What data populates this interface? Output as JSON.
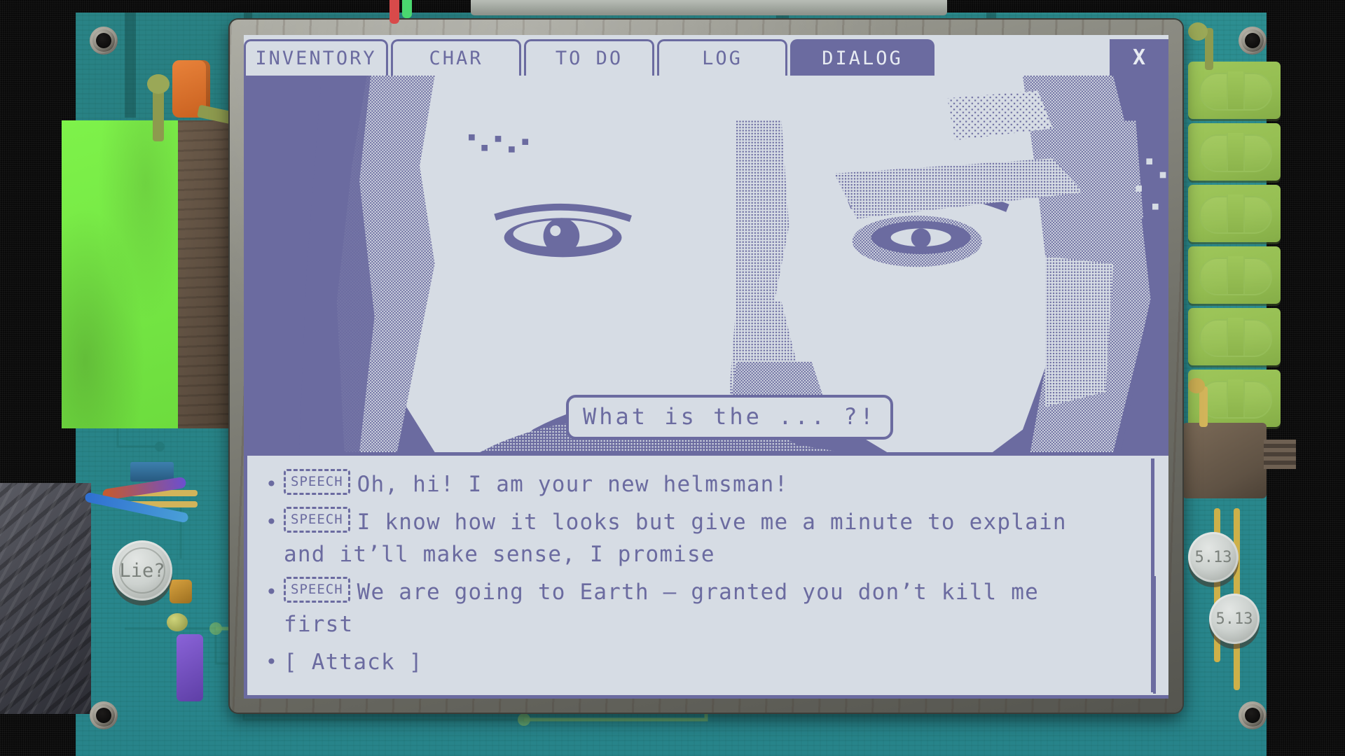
{
  "window": {
    "tabs": [
      {
        "label": "INVENTORY",
        "active": false
      },
      {
        "label": "CHAR",
        "active": false
      },
      {
        "label": "TO DO",
        "active": false
      },
      {
        "label": "LOG",
        "active": false
      },
      {
        "label": "DIALOG",
        "active": true
      }
    ],
    "close_label": "X"
  },
  "portrait": {
    "speech_bubble": "What is the ... ?!"
  },
  "dialog": {
    "bullet": "•",
    "options": [
      {
        "tag": "SPEECH",
        "text": "Oh, hi! I am your new helmsman!"
      },
      {
        "tag": "SPEECH",
        "text": "I know how it looks but give me a minute to explain and it’ll make sense, I promise"
      },
      {
        "tag": "SPEECH",
        "text": "We are going to Earth – granted you don’t kill me first"
      },
      {
        "tag": "",
        "text": "[ Attack ]"
      }
    ]
  },
  "board": {
    "lie_button": "Lie?",
    "value_badge_1": "5.13",
    "value_badge_2": "5.13"
  },
  "colors": {
    "ink": "#6b6ba0",
    "paper": "#d6dce4",
    "board_teal": "#2b8b8e",
    "card_green": "#76e845",
    "chip_green": "#95be52",
    "bezel": "#8d8d84"
  }
}
